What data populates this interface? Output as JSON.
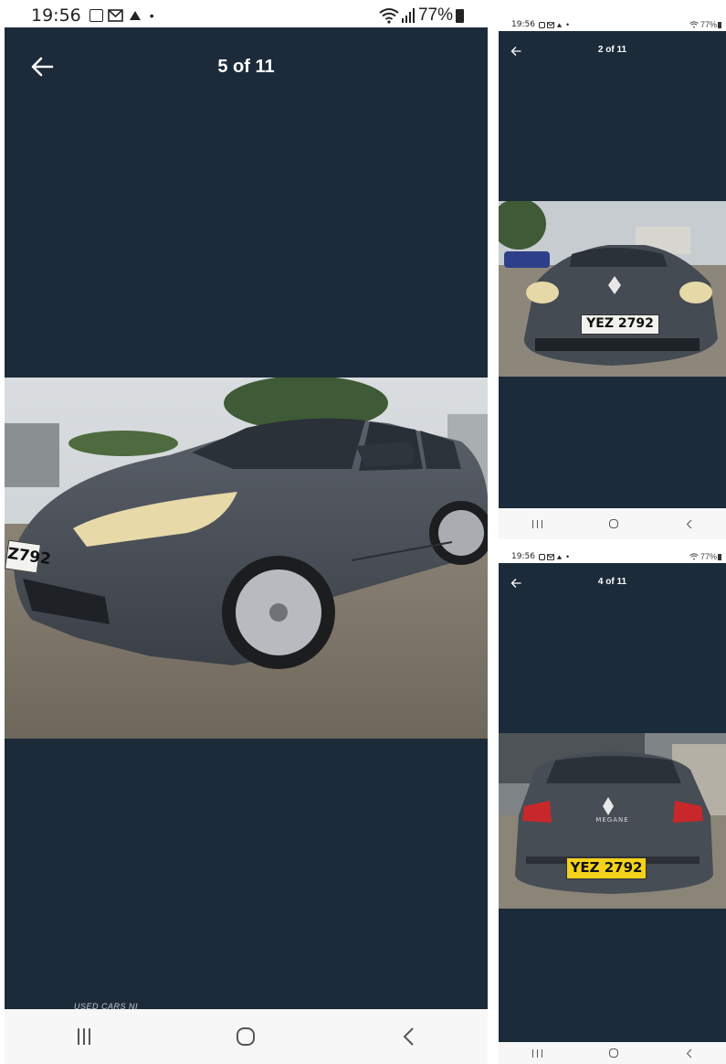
{
  "main": {
    "status": {
      "time": "19:56",
      "battery": "77%",
      "dot": "•"
    },
    "counter": "5 of 11",
    "watermark": "USED CARS NI",
    "plate": "Z792"
  },
  "top_thumb": {
    "status": {
      "time": "19:56",
      "battery": "77%",
      "dot": "•"
    },
    "counter": "2 of 11",
    "plate": "YEZ 2792"
  },
  "bottom_thumb": {
    "status": {
      "time": "19:56",
      "battery": "77%",
      "dot": "•"
    },
    "counter": "4 of 11",
    "plate": "YEZ 2792",
    "badge": "MEGANE"
  },
  "colors": {
    "viewer_bg": "#1c2b3a",
    "car_grey": "#4a5058",
    "plate_yellow": "#f3d21c",
    "plate_white": "#f2f2ee"
  },
  "icons": {
    "back": "arrow-left-icon",
    "gallery": "gallery-icon",
    "mail": "mail-icon",
    "app": "app-icon",
    "wifi": "wifi-icon",
    "signal": "signal-icon",
    "battery": "battery-icon"
  }
}
